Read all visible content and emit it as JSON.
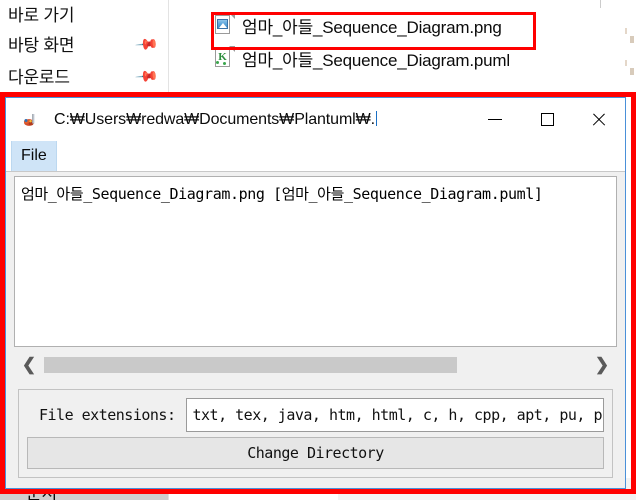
{
  "explorer": {
    "nav_items": [
      {
        "label": "바로 가기",
        "pinned": false,
        "clipped": true
      },
      {
        "label": "바탕 화면",
        "pinned": true,
        "clipped": false
      },
      {
        "label": "다운로드",
        "pinned": true,
        "clipped": false
      }
    ],
    "files": [
      {
        "name": "엄마_아들_Sequence_Diagram.png",
        "icon": "png-image-file-icon",
        "selected": true
      },
      {
        "name": "엄마_아들_Sequence_Diagram.puml",
        "icon": "plantuml-file-icon",
        "selected": false
      }
    ],
    "bottom_item_label": "문서",
    "selection_color": "#ff0000"
  },
  "java_window": {
    "title": "C:₩Users₩redwa₩Documents₩Plantuml₩.",
    "app_icon": "java-duke-icon",
    "controls": {
      "minimize": "minimize-icon",
      "maximize": "maximize-icon",
      "close": "close-icon"
    },
    "menu": {
      "items": [
        {
          "label": "File",
          "active": true
        }
      ]
    },
    "list": {
      "rows": [
        "엄마_아들_Sequence_Diagram.png [엄마_아들_Sequence_Diagram.puml]"
      ]
    },
    "scrollbar": {
      "left_arrow": "❮",
      "right_arrow": "❯",
      "thumb_fraction_percent": 76
    },
    "settings": {
      "extensions_label": "File extensions:",
      "extensions_value": "txt, tex, java, htm, html, c, h, cpp, apt, pu, puml",
      "extensions_placeholder": "txt, tex, java",
      "change_directory_label": "Change Directory"
    },
    "accent_border_color": "#4a90d9",
    "menu_highlight_color": "#cfe4f7"
  }
}
